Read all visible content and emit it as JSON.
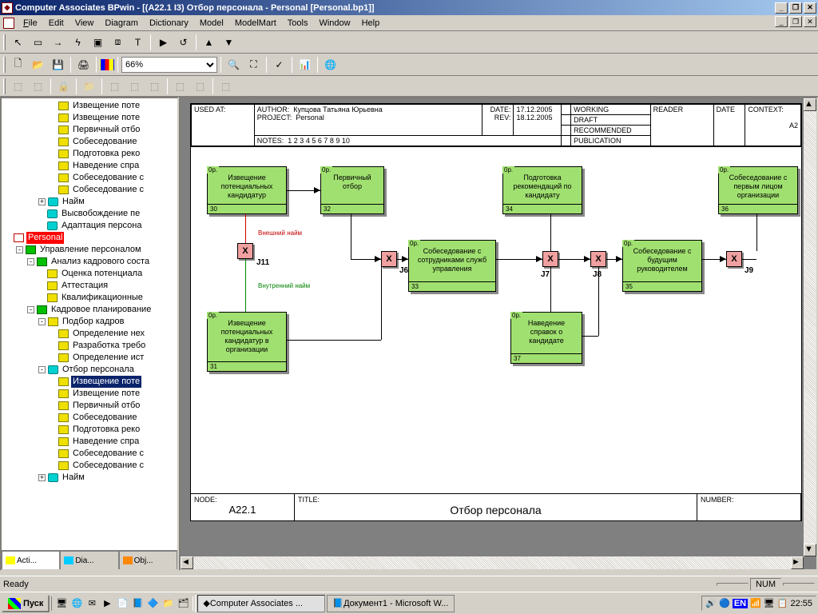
{
  "titlebar": {
    "title": "Computer Associates BPwin - [(A22.1 I3) Отбор персонала - Personal  [Personal.bp1]]"
  },
  "menu": {
    "file": "File",
    "edit": "Edit",
    "view": "View",
    "diagram": "Diagram",
    "dictionary": "Dictionary",
    "model": "Model",
    "modelmart": "ModelMart",
    "tools": "Tools",
    "window": "Window",
    "help": "Help"
  },
  "zoom": "66%",
  "tree": {
    "items": [
      {
        "indent": 4,
        "icon": "yellow",
        "label": "Извещение поте"
      },
      {
        "indent": 4,
        "icon": "yellow",
        "label": "Извещение поте"
      },
      {
        "indent": 4,
        "icon": "yellow",
        "label": "Первичный отбо"
      },
      {
        "indent": 4,
        "icon": "yellow",
        "label": "Собеседование"
      },
      {
        "indent": 4,
        "icon": "yellow",
        "label": "Подготовка реко"
      },
      {
        "indent": 4,
        "icon": "yellow",
        "label": "Наведение спра"
      },
      {
        "indent": 4,
        "icon": "yellow",
        "label": "Собеседование с"
      },
      {
        "indent": 4,
        "icon": "yellow",
        "label": "Собеседование с"
      },
      {
        "indent": 3,
        "icon": "cyan",
        "exp": "+",
        "label": "Найм"
      },
      {
        "indent": 3,
        "icon": "cyan",
        "label": "Высвобождение пе"
      },
      {
        "indent": 3,
        "icon": "cyan",
        "label": "Адаптация персона"
      },
      {
        "indent": 0,
        "icon": "red",
        "label": "Personal",
        "sel": "red"
      },
      {
        "indent": 1,
        "icon": "green",
        "exp": "-",
        "label": "Управление персоналом"
      },
      {
        "indent": 2,
        "icon": "green",
        "exp": "-",
        "label": "Анализ кадрового соста"
      },
      {
        "indent": 3,
        "icon": "yellow",
        "label": "Оценка потенциала"
      },
      {
        "indent": 3,
        "icon": "yellow",
        "label": "Аттестация"
      },
      {
        "indent": 3,
        "icon": "yellow",
        "label": "Квалификационные"
      },
      {
        "indent": 2,
        "icon": "green",
        "exp": "-",
        "label": "Кадровое планирование"
      },
      {
        "indent": 3,
        "icon": "yellow",
        "exp": "-",
        "label": "Подбор кадров"
      },
      {
        "indent": 4,
        "icon": "yellow",
        "label": "Определение нех"
      },
      {
        "indent": 4,
        "icon": "yellow",
        "label": "Разработка требо"
      },
      {
        "indent": 4,
        "icon": "yellow",
        "label": "Определение ист"
      },
      {
        "indent": 3,
        "icon": "cyan",
        "exp": "-",
        "label": "Отбор персонала"
      },
      {
        "indent": 4,
        "icon": "yellow",
        "label": "Извещение поте",
        "sel": "blue"
      },
      {
        "indent": 4,
        "icon": "yellow",
        "label": "Извещение поте"
      },
      {
        "indent": 4,
        "icon": "yellow",
        "label": "Первичный отбо"
      },
      {
        "indent": 4,
        "icon": "yellow",
        "label": "Собеседование"
      },
      {
        "indent": 4,
        "icon": "yellow",
        "label": "Подготовка реко"
      },
      {
        "indent": 4,
        "icon": "yellow",
        "label": "Наведение спра"
      },
      {
        "indent": 4,
        "icon": "yellow",
        "label": "Собеседование с"
      },
      {
        "indent": 4,
        "icon": "yellow",
        "label": "Собеседование с"
      },
      {
        "indent": 3,
        "icon": "cyan",
        "exp": "+",
        "label": "Найм"
      }
    ],
    "tabs": {
      "acti": "Acti...",
      "dia": "Dia...",
      "obj": "Obj..."
    }
  },
  "diagram": {
    "header": {
      "used_at_label": "USED AT:",
      "author_label": "AUTHOR:",
      "author": "Купцова Татьяна Юрьевна",
      "project_label": "PROJECT:",
      "project": "Personal",
      "date_label": "DATE:",
      "date": "17.12.2005",
      "rev_label": "REV:",
      "rev": "18.12.2005",
      "working": "WORKING",
      "draft": "DRAFT",
      "recommended": "RECOMMENDED",
      "publication": "PUBLICATION",
      "reader": "READER",
      "reader_date": "DATE",
      "context": "CONTEXT:",
      "context_val": "A2",
      "notes_label": "NOTES:",
      "notes": "1  2  3  4  5  6  7  8  9  10"
    },
    "footer": {
      "node_label": "NODE:",
      "node": "A22.1",
      "title_label": "TITLE:",
      "title": "Отбор персонала",
      "number_label": "NUMBER:"
    },
    "boxes": {
      "b30": {
        "num": "30",
        "title": "Извещение потенциальных кандидатур"
      },
      "b31": {
        "num": "31",
        "title": "Извещение потенциальных кандидатур в организации"
      },
      "b32": {
        "num": "32",
        "title": "Первичный отбор"
      },
      "b33": {
        "num": "33",
        "title": "Собеседование с сотрудниками служб управления"
      },
      "b34": {
        "num": "34",
        "title": "Подготовка рекомендаций по кандидату"
      },
      "b35": {
        "num": "35",
        "title": "Собеседование с будущим руководителем"
      },
      "b36": {
        "num": "36",
        "title": "Собеседование с первым лицом организации"
      },
      "b37": {
        "num": "37",
        "title": "Наведение справок о кандидате"
      }
    },
    "junctions": {
      "j11": "J11",
      "j6": "J6",
      "j7": "J7",
      "j8": "J8",
      "j9": "J9",
      "x": "X"
    },
    "arrows": {
      "ext": "Внешний найм",
      "int": "Внутренний найм"
    }
  },
  "status": {
    "ready": "Ready",
    "num": "NUM"
  },
  "taskbar": {
    "start": "Пуск",
    "task1": "Computer Associates ...",
    "task2": "Документ1 - Microsoft W...",
    "lang": "EN",
    "time": "22:55"
  }
}
